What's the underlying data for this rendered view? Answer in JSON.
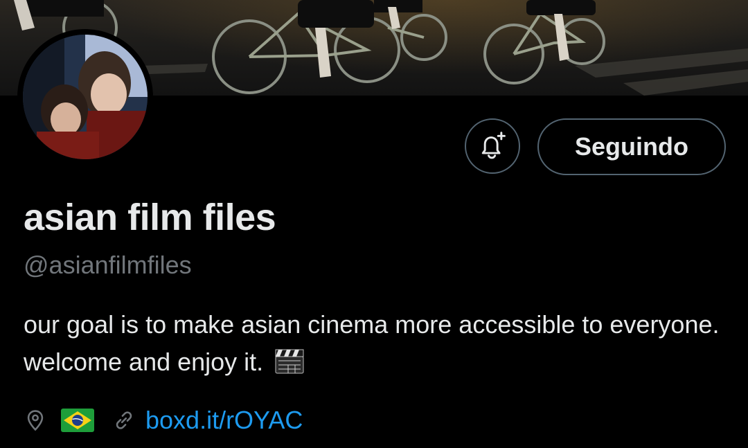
{
  "profile": {
    "display_name": "asian film files",
    "handle": "@asianfilmfiles",
    "bio": "our goal is to make asian cinema more accessible to everyone. welcome and enjoy it.",
    "bio_emoji": "clapper-board-icon",
    "location_flag": "brazil-flag",
    "website": "boxd.it/rOYAC"
  },
  "actions": {
    "notify_icon": "bell-plus-icon",
    "follow_label": "Seguindo"
  },
  "colors": {
    "background": "#000000",
    "text": "#e7e9ea",
    "secondary_text": "#71767b",
    "link": "#1d9bf0",
    "button_border": "#536471"
  }
}
